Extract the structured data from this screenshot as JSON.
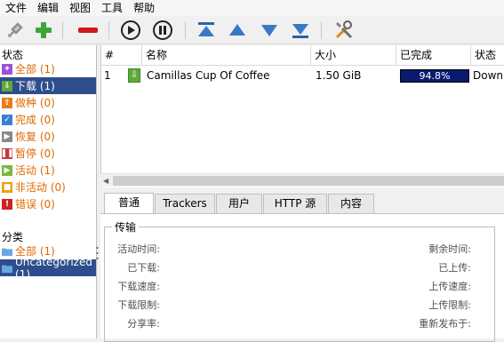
{
  "menu": [
    "文件",
    "编辑",
    "视图",
    "工具",
    "帮助"
  ],
  "sidebar": {
    "status_header": "状态",
    "status_items": [
      {
        "label": "全部 (1)",
        "color": "#a050d8",
        "icon": "all-icon"
      },
      {
        "label": "下载 (1)",
        "color": "#5fa83a",
        "icon": "download-icon",
        "selected": true
      },
      {
        "label": "做种 (0)",
        "color": "#e87b1c",
        "icon": "seed-icon"
      },
      {
        "label": "完成 (0)",
        "color": "#3c7ed6",
        "icon": "complete-icon"
      },
      {
        "label": "恢复 (0)",
        "color": "#888888",
        "icon": "resume-icon"
      },
      {
        "label": "暂停 (0)",
        "color": "#c23a3a",
        "icon": "pause-icon"
      },
      {
        "label": "活动 (1)",
        "color": "#7ab83c",
        "icon": "active-icon"
      },
      {
        "label": "非活动 (0)",
        "color": "#f0a000",
        "icon": "inactive-icon"
      },
      {
        "label": "错误 (0)",
        "color": "#d02020",
        "icon": "error-icon"
      }
    ],
    "category_header": "分类",
    "category_items": [
      {
        "label": "全部 (1)"
      },
      {
        "label": "Uncategorized (1)",
        "selected": true
      }
    ]
  },
  "table": {
    "headers": [
      "#",
      "名称",
      "大小",
      "已完成",
      "状态"
    ],
    "rows": [
      {
        "num": "1",
        "name": "Camillas Cup Of Coffee",
        "size": "1.50 GiB",
        "progress_text": "94.8%",
        "progress": 0.948,
        "status": "Downlo"
      }
    ]
  },
  "tabs": [
    "普通",
    "Trackers",
    "用户",
    "HTTP 源",
    "内容"
  ],
  "transfer": {
    "title": "传输",
    "left_labels": [
      "活动时间:",
      "已下载:",
      "下载速度:",
      "下载限制:",
      "分享率:"
    ],
    "right_labels": [
      "剩余时间:",
      "已上传:",
      "上传速度:",
      "上传限制:",
      "重新发布于:"
    ]
  },
  "colors": {
    "selection": "#2e4d8c",
    "progress_fill": "#0a1a6e",
    "status_text": "#e06800"
  }
}
